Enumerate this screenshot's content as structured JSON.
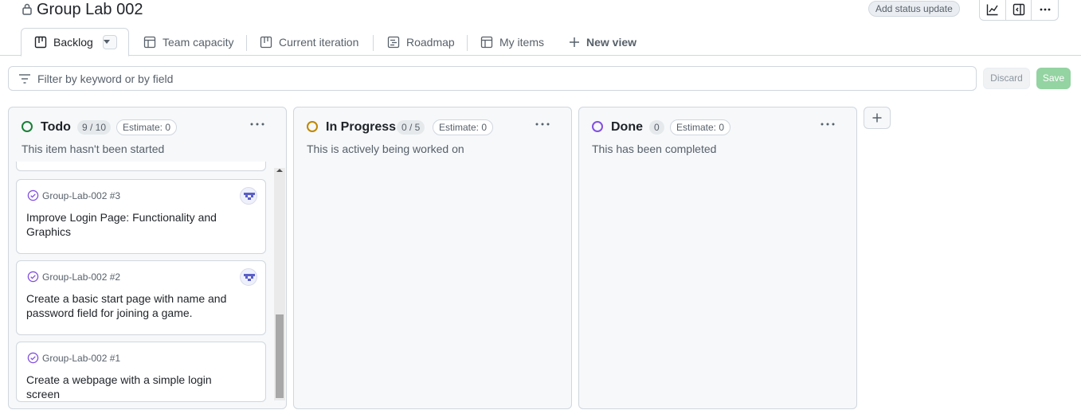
{
  "header": {
    "title": "Group Lab 002",
    "status_button": "Add status update",
    "toolbar_icons": [
      "insights-icon",
      "sidebar-icon",
      "more-icon"
    ]
  },
  "tabs": [
    {
      "label": "Backlog",
      "icon": "board-icon",
      "active": true
    },
    {
      "label": "Team capacity",
      "icon": "table-icon"
    },
    {
      "label": "Current iteration",
      "icon": "board-icon"
    },
    {
      "label": "Roadmap",
      "icon": "roadmap-icon"
    },
    {
      "label": "My items",
      "icon": "table-icon"
    },
    {
      "label": "New view",
      "icon": "plus-icon"
    }
  ],
  "filter": {
    "placeholder": "Filter by keyword or by field",
    "value": ""
  },
  "actions": {
    "discard": "Discard",
    "save": "Save"
  },
  "columns": [
    {
      "name": "Todo",
      "count": "9 / 10",
      "estimate": "Estimate: 0",
      "description": "This item hasn't been started",
      "status_color": "#1a7f37",
      "cards": [
        {
          "repo": "Group-Lab-002 #3",
          "title": "Improve Login Page: Functionality and Graphics",
          "has_avatar": true
        },
        {
          "repo": "Group-Lab-002 #2",
          "title": "Create a basic start page with name and password field for joining a game.",
          "has_avatar": true
        },
        {
          "repo": "Group-Lab-002 #1",
          "title": "Create a webpage with a simple login screen",
          "has_avatar": false
        }
      ]
    },
    {
      "name": "In Progress",
      "count": "0 / 5",
      "estimate": "Estimate: 0",
      "description": "This is actively being worked on",
      "status_color": "#bf8700",
      "cards": []
    },
    {
      "name": "Done",
      "count": "0",
      "estimate": "Estimate: 0",
      "description": "This has been completed",
      "status_color": "#8250df",
      "cards": []
    }
  ],
  "colors": {
    "issue_open_purple": "#8250df",
    "save_green": "#94d3a2"
  }
}
